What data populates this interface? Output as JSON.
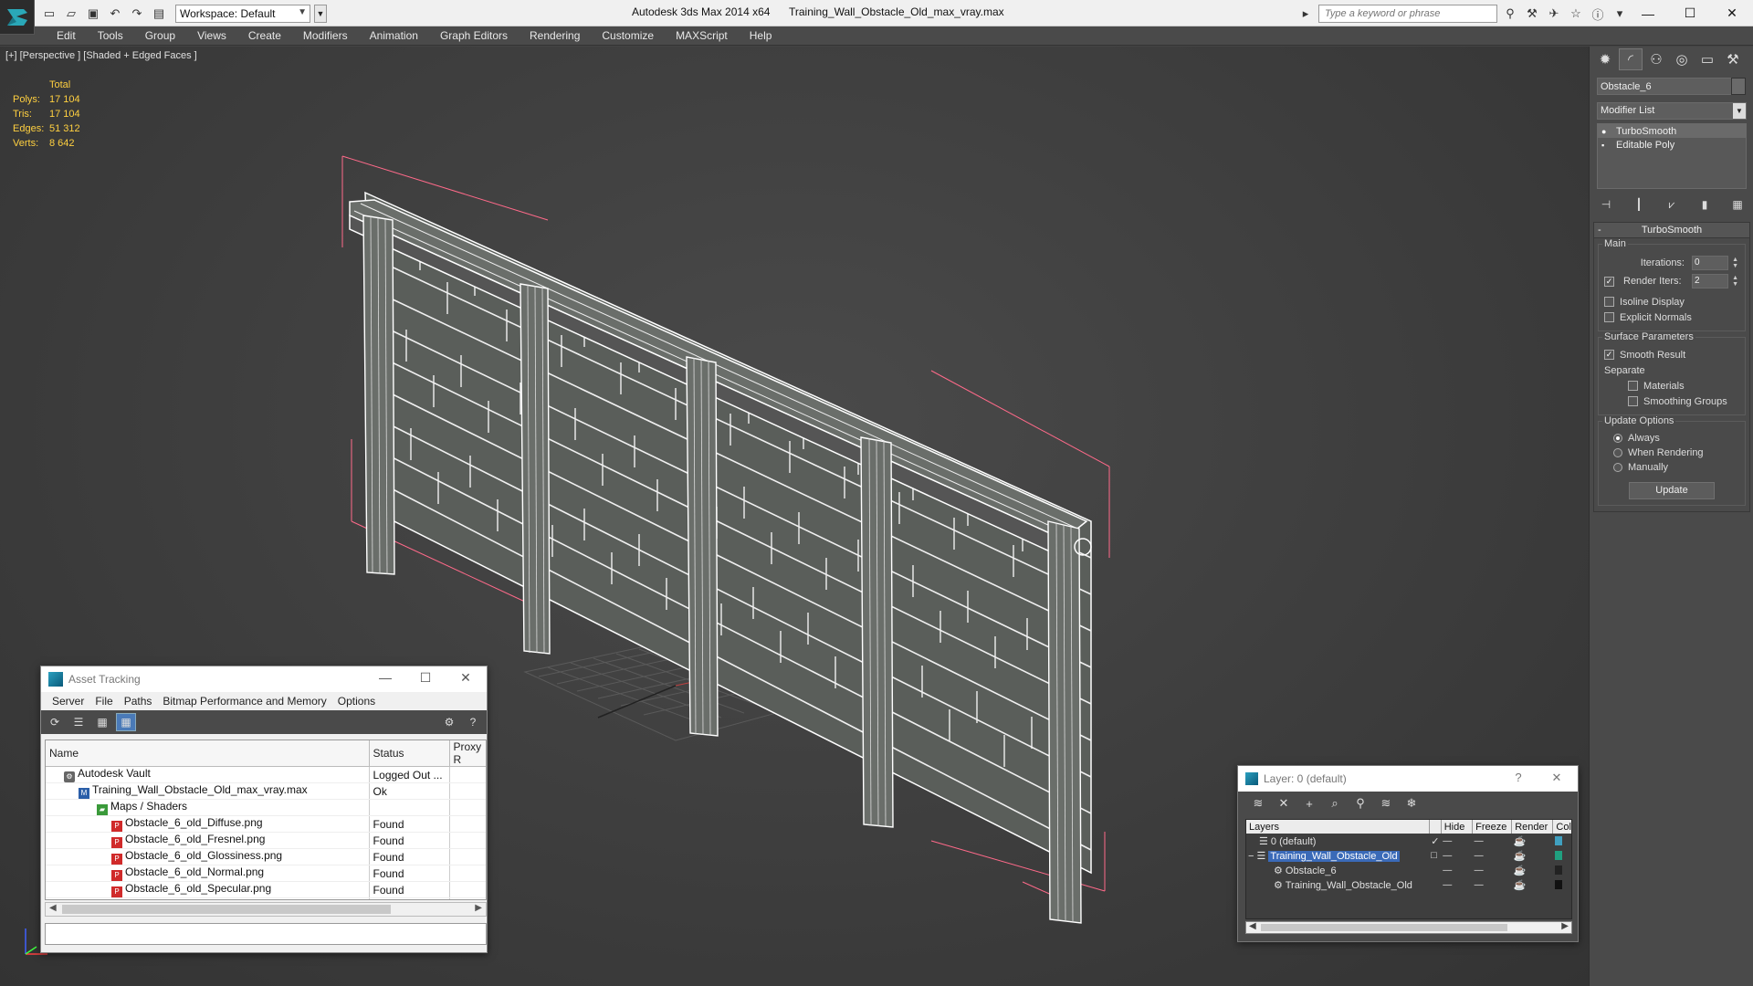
{
  "titlebar": {
    "workspace": "Workspace: Default",
    "app_title": "Autodesk 3ds Max  2014 x64",
    "doc_title": "Training_Wall_Obstacle_Old_max_vray.max",
    "search_placeholder": "Type a keyword or phrase"
  },
  "menu": [
    "Edit",
    "Tools",
    "Group",
    "Views",
    "Create",
    "Modifiers",
    "Animation",
    "Graph Editors",
    "Rendering",
    "Customize",
    "MAXScript",
    "Help"
  ],
  "viewport": {
    "label": "[+] [Perspective ] [Shaded + Edged Faces ]",
    "stats": {
      "header": "Total",
      "polys_label": "Polys:",
      "polys": "17 104",
      "tris_label": "Tris:",
      "tris": "17 104",
      "edges_label": "Edges:",
      "edges": "51 312",
      "verts_label": "Verts:",
      "verts": "8 642"
    },
    "stat_color": "#ffd040",
    "wire_color": "#ffffff",
    "bbox_color": "#ff6a8a"
  },
  "command_panel": {
    "object_name": "Obstacle_6",
    "modifier_list": "Modifier List",
    "stack": [
      "TurboSmooth",
      "Editable Poly"
    ],
    "turbosmooth": {
      "title": "TurboSmooth",
      "main_label": "Main",
      "iterations_label": "Iterations:",
      "iterations": "0",
      "render_iters_label": "Render Iters:",
      "render_iters": "2",
      "isoline": "Isoline Display",
      "explicit_normals": "Explicit Normals",
      "surface_params": "Surface Parameters",
      "smooth_result": "Smooth Result",
      "separate": "Separate",
      "materials": "Materials",
      "smoothing_groups": "Smoothing Groups",
      "update_options": "Update Options",
      "always": "Always",
      "when_rendering": "When Rendering",
      "manually": "Manually",
      "update_button": "Update"
    }
  },
  "asset_tracking": {
    "title": "Asset Tracking",
    "menu": [
      "Server",
      "File",
      "Paths",
      "Bitmap Performance and Memory",
      "Options"
    ],
    "columns": [
      "Name",
      "Status",
      "Proxy R"
    ],
    "rows": [
      {
        "name": "Autodesk Vault",
        "status": "Logged Out ...",
        "icon": "vault-icon"
      },
      {
        "name": "Training_Wall_Obstacle_Old_max_vray.max",
        "status": "Ok",
        "icon": "max-file-icon"
      },
      {
        "name": "Maps / Shaders",
        "status": "",
        "icon": "maps-folder-icon"
      },
      {
        "name": "Obstacle_6_old_Diffuse.png",
        "status": "Found",
        "icon": "png-file-icon"
      },
      {
        "name": "Obstacle_6_old_Fresnel.png",
        "status": "Found",
        "icon": "png-file-icon"
      },
      {
        "name": "Obstacle_6_old_Glossiness.png",
        "status": "Found",
        "icon": "png-file-icon"
      },
      {
        "name": "Obstacle_6_old_Normal.png",
        "status": "Found",
        "icon": "png-file-icon"
      },
      {
        "name": "Obstacle_6_old_Specular.png",
        "status": "Found",
        "icon": "png-file-icon"
      }
    ]
  },
  "layer_window": {
    "title": "Layer: 0 (default)",
    "help": "?",
    "columns": [
      "Layers",
      "Hide",
      "Freeze",
      "Render",
      "Col"
    ],
    "rows": [
      {
        "name": "0 (default)",
        "color": "#40a0c0"
      },
      {
        "name": "Training_Wall_Obstacle_Old",
        "color": "#20a080"
      },
      {
        "name": "Obstacle_6",
        "color": "#222222"
      },
      {
        "name": "Training_Wall_Obstacle_Old",
        "color": "#111111"
      }
    ]
  }
}
